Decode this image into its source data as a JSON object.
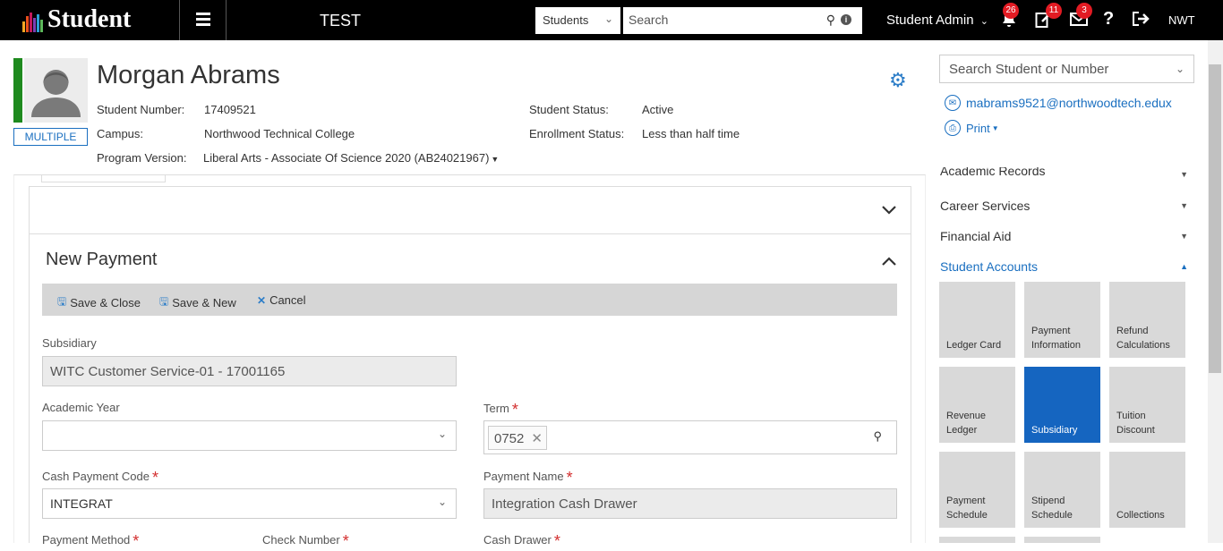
{
  "app": {
    "name": "Student",
    "environment": "TEST",
    "org": "NWT"
  },
  "header": {
    "scope_select": "Students",
    "search_placeholder": "Search",
    "user": "Student Admin",
    "badges": {
      "notifications": "26",
      "tasks": "11",
      "messages": "3"
    }
  },
  "student": {
    "name": "Morgan Abrams",
    "multiple_label": "MULTIPLE",
    "labels": {
      "number": "Student Number:",
      "campus": "Campus:",
      "program": "Program Version:",
      "status": "Student Status:",
      "enrollment": "Enrollment Status:"
    },
    "values": {
      "number": "17409521",
      "campus": "Northwood Technical College",
      "program": "Liberal Arts - Associate Of Science 2020 (AB24021967)",
      "status": "Active",
      "enrollment": "Less than half time"
    }
  },
  "sidebar": {
    "search_placeholder": "Search Student or Number",
    "email": "mabrams9521@northwoodtech.edux",
    "print_label": "Print",
    "nav": [
      {
        "label": "Academic Records"
      },
      {
        "label": "Career Services"
      },
      {
        "label": "Financial Aid"
      },
      {
        "label": "Student Accounts"
      }
    ],
    "tiles": [
      {
        "label": "Ledger Card"
      },
      {
        "label": "Payment Information"
      },
      {
        "label": "Refund Calculations"
      },
      {
        "label": "Revenue Ledger"
      },
      {
        "label": "Subsidiary"
      },
      {
        "label": "Tuition Discount"
      },
      {
        "label": "Payment Schedule"
      },
      {
        "label": "Stipend Schedule"
      },
      {
        "label": "Collections"
      }
    ]
  },
  "form": {
    "title": "New Payment",
    "toolbar": {
      "save_close": "Save & Close",
      "save_new": "Save & New",
      "cancel": "Cancel"
    },
    "fields": {
      "subsidiary": {
        "label": "Subsidiary",
        "value": "WITC Customer Service-01 - 17001165"
      },
      "academic_year": {
        "label": "Academic Year",
        "value": ""
      },
      "term": {
        "label": "Term",
        "chip": "0752"
      },
      "cash_payment_code": {
        "label": "Cash Payment Code",
        "value": "INTEGRAT"
      },
      "payment_name": {
        "label": "Payment Name",
        "value": "Integration Cash Drawer"
      },
      "payment_method": {
        "label": "Payment Method"
      },
      "check_number": {
        "label": "Check Number"
      },
      "cash_drawer": {
        "label": "Cash Drawer"
      }
    }
  },
  "colors": {
    "accent": "#1a6fc0",
    "active_tile": "#1565c0",
    "status_strip": "#1e8a1e",
    "badge": "#e21b23"
  }
}
